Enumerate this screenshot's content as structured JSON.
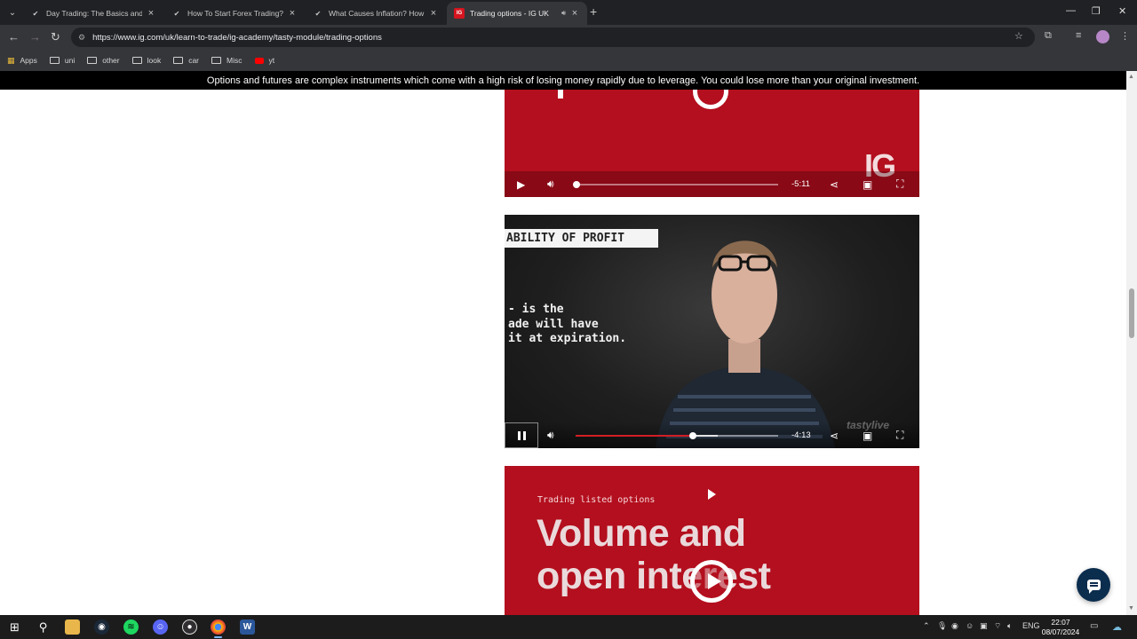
{
  "browser": {
    "tabs": [
      {
        "title": "Day Trading: The Basics and Ho",
        "favicon": "investopedia-icon",
        "active": false
      },
      {
        "title": "How To Start Forex Trading? A",
        "favicon": "investopedia-icon",
        "active": false
      },
      {
        "title": "What Causes Inflation? How It's",
        "favicon": "investopedia-icon",
        "active": false
      },
      {
        "title": "Trading options - IG UK",
        "favicon": "ig-icon",
        "favicon_text": "IG",
        "active": true,
        "audio": true
      }
    ],
    "url": "https://www.ig.com/uk/learn-to-trade/ig-academy/tasty-module/trading-options",
    "bookmarks": [
      {
        "label": "Apps",
        "icon": "apps-icon"
      },
      {
        "label": "uni",
        "icon": "folder-icon"
      },
      {
        "label": "other",
        "icon": "folder-icon"
      },
      {
        "label": "look",
        "icon": "folder-icon"
      },
      {
        "label": "car",
        "icon": "folder-icon"
      },
      {
        "label": "Misc",
        "icon": "folder-icon"
      },
      {
        "label": "yt",
        "icon": "youtube-icon"
      }
    ]
  },
  "page": {
    "risk_warning": "Options and futures are complex instruments which come with a high risk of losing money rapidly due to leverage. You could lose more than your original investment.",
    "videos": [
      {
        "logo": "IG",
        "time_remaining": "-5:11",
        "progress": 0.0,
        "state": "paused"
      },
      {
        "overlay_label": "ABILITY OF PROFIT",
        "overlay_quote": [
          "- is the",
          "ade will have",
          "it at expiration."
        ],
        "watermark": "tastylive",
        "time_remaining": "-4:13",
        "progress": 0.58,
        "buffered": 0.7,
        "state": "playing"
      },
      {
        "eyebrow": "Trading listed options",
        "headline_line1": "Volume and",
        "headline_line2": "open interest",
        "state": "paused"
      }
    ]
  },
  "taskbar": {
    "apps": [
      "windows-start-icon",
      "search-icon",
      "file-explorer-icon",
      "steam-icon",
      "spotify-icon",
      "discord-icon",
      "obs-icon",
      "chrome-icon",
      "word-icon"
    ],
    "language": "ENG",
    "time": "22:07",
    "date": "08/07/2024"
  },
  "colors": {
    "ig_red": "#b30f1e",
    "progress_red": "#d21e26",
    "chat_navy": "#0b2d4e"
  }
}
